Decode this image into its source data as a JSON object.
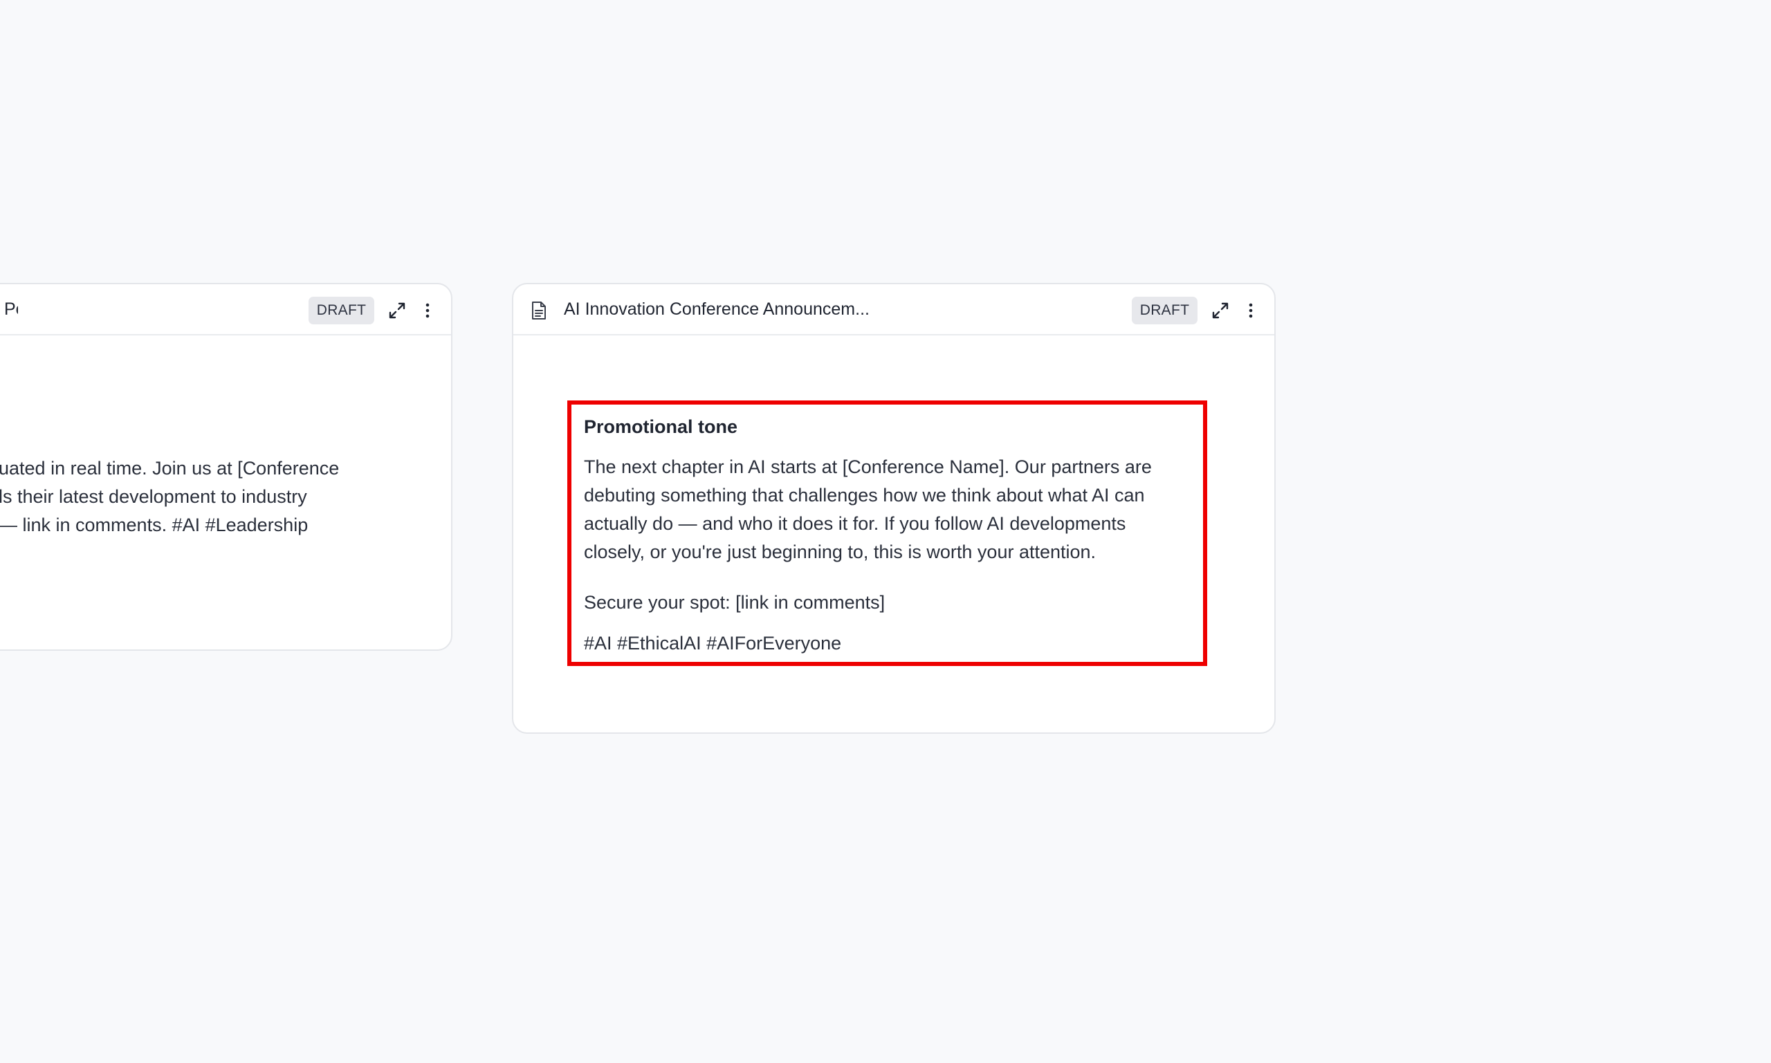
{
  "left_card": {
    "title": "Post",
    "badge": "DRAFT",
    "body_lines": [
      "uated in real time. Join us at [Conference",
      "ls their latest development to industry",
      "— link in comments. #AI #Leadership"
    ]
  },
  "right_card": {
    "title": "AI Innovation Conference Announcem...",
    "badge": "DRAFT",
    "highlight": {
      "heading": "Promotional tone",
      "body": "The next chapter in AI starts at [Conference Name]. Our partners are\ndebuting something that challenges how we think about what AI can\nactually do — and who it does it for. If you follow AI developments\nclosely, or you're just beginning to, this is worth your attention.",
      "cta": "Secure your spot: [link in comments]",
      "tags": "#AI #EthicalAI #AIForEveryone"
    }
  },
  "icons": {
    "document": "document-icon",
    "expand": "expand-icon",
    "more": "more-vertical-icon"
  },
  "colors": {
    "background": "#f8f9fb",
    "card": "#ffffff",
    "badge_bg": "#e7e8ec",
    "highlight_border": "#ee0000"
  }
}
